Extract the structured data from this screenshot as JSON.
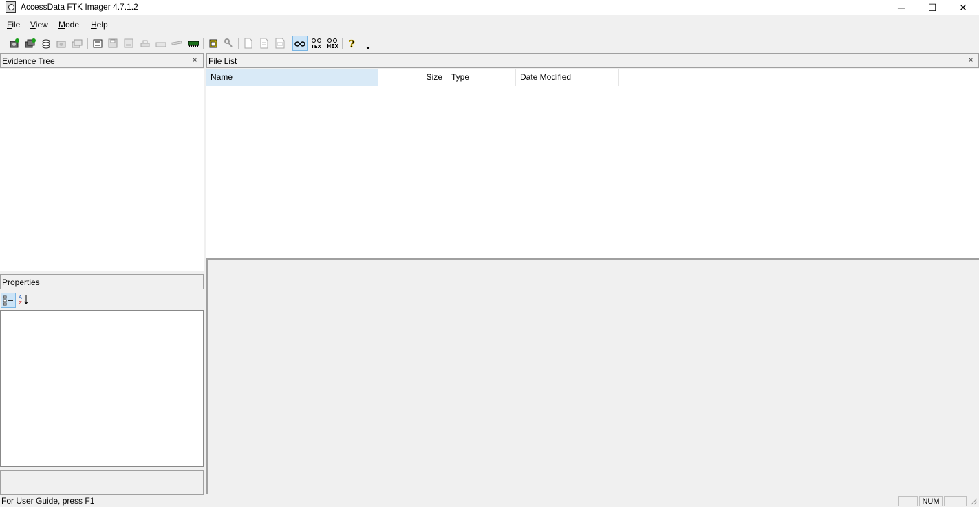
{
  "window": {
    "title": "AccessData FTK Imager 4.7.1.2",
    "controls": {
      "minimize": "─",
      "maximize": "☐",
      "close": "✕"
    }
  },
  "menu": [
    {
      "label": "File",
      "accel": "F",
      "rest": "ile"
    },
    {
      "label": "View",
      "accel": "V",
      "rest": "iew"
    },
    {
      "label": "Mode",
      "accel": "M",
      "rest": "ode"
    },
    {
      "label": "Help",
      "accel": "H",
      "rest": "elp"
    }
  ],
  "toolbar": {
    "icons": [
      "add-evidence-icon",
      "add-all-attached-devices-icon",
      "image-mounting-icon",
      "remove-evidence-icon",
      "remove-all-evidence-icon",
      "create-disk-image-icon",
      "export-disk-image-icon",
      "export-logical-image-icon",
      "add-to-custom-content-image-icon",
      "create-custom-content-image-icon",
      "decrypt-ad1-image-icon",
      "capture-memory-icon",
      "obtain-protected-files-icon",
      "detect-efs-encryption-icon",
      "export-files-icon",
      "export-file-hash-list-icon",
      "export-directory-listing-icon",
      "auto-view-mode-icon",
      "text-view-mode-icon",
      "hex-view-mode-icon",
      "help-icon",
      "toolbar-overflow-icon"
    ],
    "active_icon": "auto-view-mode-icon"
  },
  "evidence_tree": {
    "title": "Evidence Tree",
    "close": "×"
  },
  "file_list": {
    "title": "File List",
    "close": "×",
    "columns": [
      "Name",
      "Size",
      "Type",
      "Date Modified"
    ]
  },
  "properties": {
    "title": "Properties"
  },
  "status": {
    "text": "For User Guide, press F1",
    "num": "NUM"
  }
}
